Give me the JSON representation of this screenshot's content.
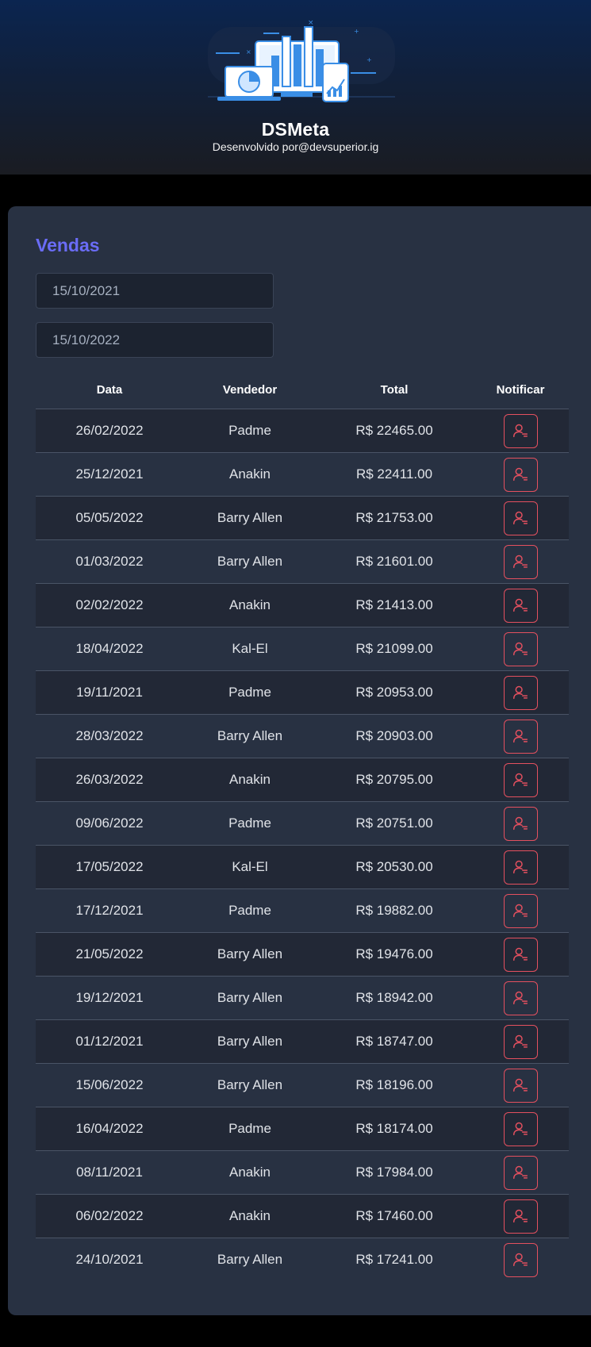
{
  "header": {
    "title": "DSMeta",
    "subtitle": "Desenvolvido por@devsuperior.ig",
    "logo_icon": "analytics-dashboard-illustration"
  },
  "sales": {
    "title": "Vendas",
    "min_date": "15/10/2021",
    "max_date": "15/10/2022",
    "columns": [
      "Data",
      "Vendedor",
      "Total",
      "Notificar"
    ],
    "notify_icon": "user-notify-icon",
    "rows": [
      {
        "date": "26/02/2022",
        "seller": "Padme",
        "total": "R$ 22465.00"
      },
      {
        "date": "25/12/2021",
        "seller": "Anakin",
        "total": "R$ 22411.00"
      },
      {
        "date": "05/05/2022",
        "seller": "Barry Allen",
        "total": "R$ 21753.00"
      },
      {
        "date": "01/03/2022",
        "seller": "Barry Allen",
        "total": "R$ 21601.00"
      },
      {
        "date": "02/02/2022",
        "seller": "Anakin",
        "total": "R$ 21413.00"
      },
      {
        "date": "18/04/2022",
        "seller": "Kal-El",
        "total": "R$ 21099.00"
      },
      {
        "date": "19/11/2021",
        "seller": "Padme",
        "total": "R$ 20953.00"
      },
      {
        "date": "28/03/2022",
        "seller": "Barry Allen",
        "total": "R$ 20903.00"
      },
      {
        "date": "26/03/2022",
        "seller": "Anakin",
        "total": "R$ 20795.00"
      },
      {
        "date": "09/06/2022",
        "seller": "Padme",
        "total": "R$ 20751.00"
      },
      {
        "date": "17/05/2022",
        "seller": "Kal-El",
        "total": "R$ 20530.00"
      },
      {
        "date": "17/12/2021",
        "seller": "Padme",
        "total": "R$ 19882.00"
      },
      {
        "date": "21/05/2022",
        "seller": "Barry Allen",
        "total": "R$ 19476.00"
      },
      {
        "date": "19/12/2021",
        "seller": "Barry Allen",
        "total": "R$ 18942.00"
      },
      {
        "date": "01/12/2021",
        "seller": "Barry Allen",
        "total": "R$ 18747.00"
      },
      {
        "date": "15/06/2022",
        "seller": "Barry Allen",
        "total": "R$ 18196.00"
      },
      {
        "date": "16/04/2022",
        "seller": "Padme",
        "total": "R$ 18174.00"
      },
      {
        "date": "08/11/2021",
        "seller": "Anakin",
        "total": "R$ 17984.00"
      },
      {
        "date": "06/02/2022",
        "seller": "Anakin",
        "total": "R$ 17460.00"
      },
      {
        "date": "24/10/2021",
        "seller": "Barry Allen",
        "total": "R$ 17241.00"
      }
    ]
  },
  "colors": {
    "accent": "#6A6CF6",
    "notify": "#E4505F",
    "card": "#283142",
    "background": "#000000"
  }
}
